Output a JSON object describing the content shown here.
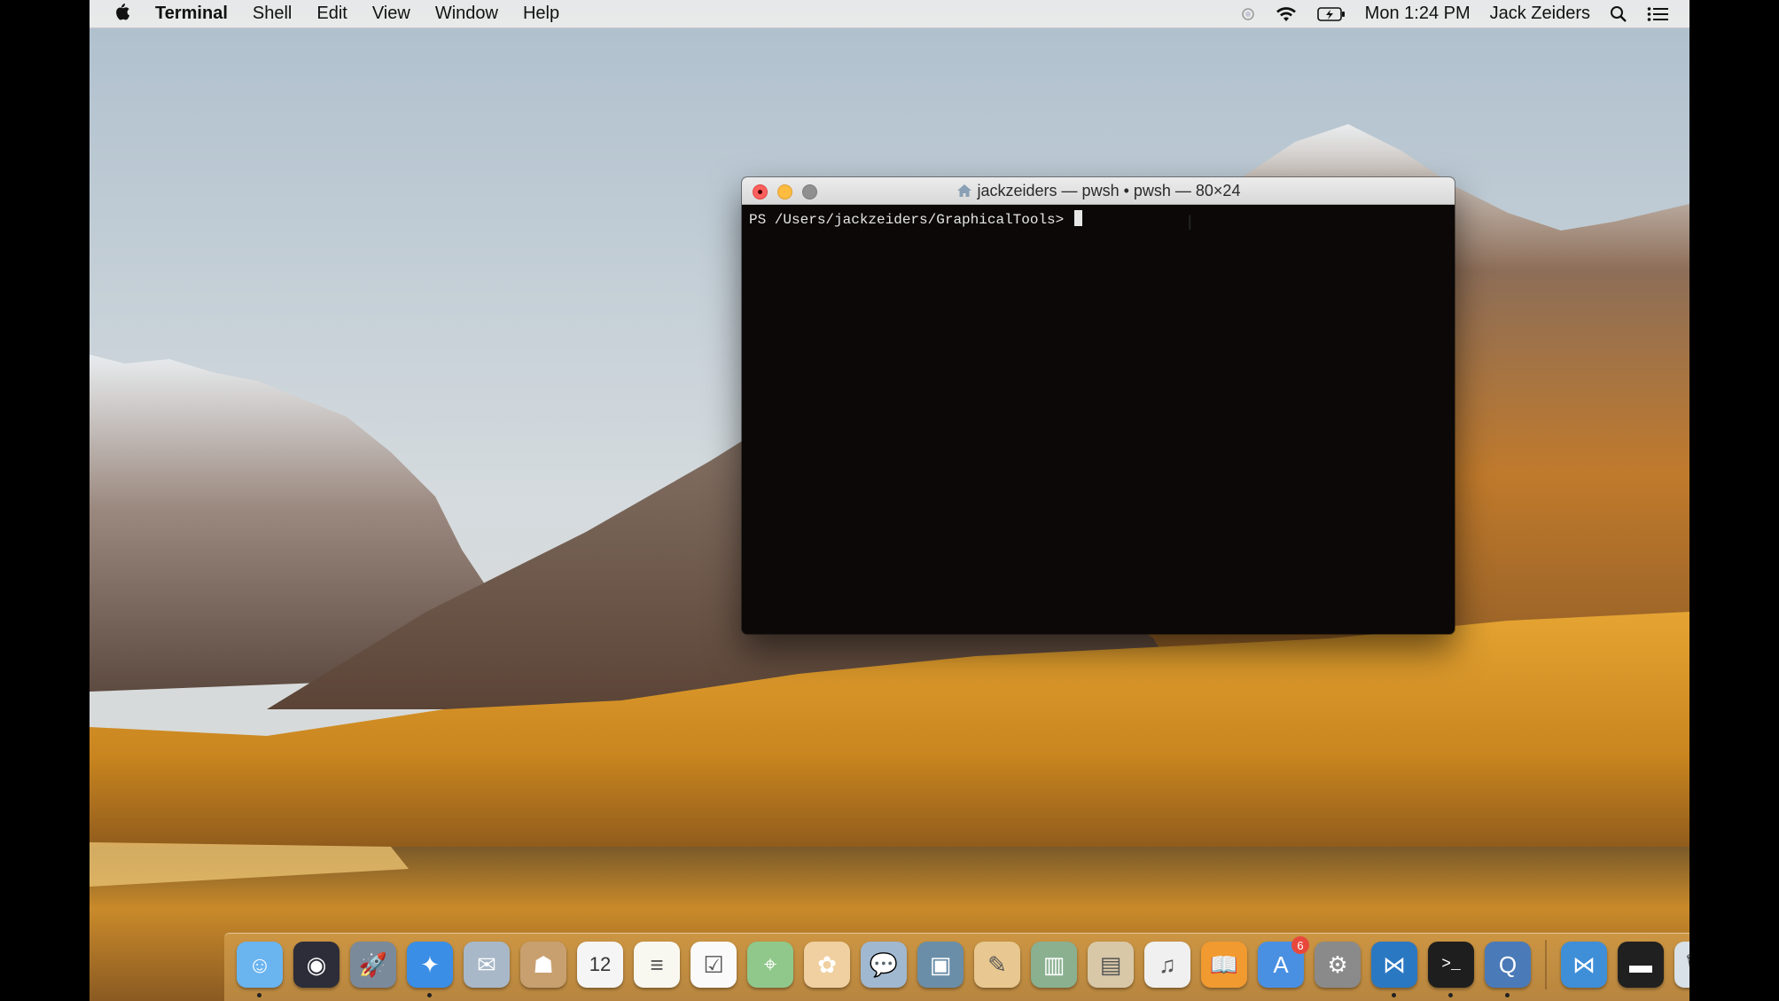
{
  "menubar": {
    "apple_icon": "apple-logo",
    "app_name": "Terminal",
    "menus": [
      "Shell",
      "Edit",
      "View",
      "Window",
      "Help"
    ],
    "clock": "Mon 1:24 PM",
    "user": "Jack Zeiders",
    "status_icons": [
      "siri-dot-icon",
      "wifi-icon",
      "battery-charging-icon",
      "spotlight-search-icon",
      "notification-center-icon"
    ]
  },
  "terminal": {
    "title": "jackzeiders — pwsh • pwsh — 80×24",
    "prompt": "PS /Users/jackzeiders/GraphicalTools> "
  },
  "dock": {
    "apps": [
      {
        "name": "Finder",
        "icon": "finder-icon",
        "color": "#6ab4f0",
        "running": true
      },
      {
        "name": "Siri",
        "icon": "siri-icon",
        "color": "#2d2d3a",
        "running": false
      },
      {
        "name": "Launchpad",
        "icon": "launchpad-icon",
        "color": "#7b8a9a",
        "running": false
      },
      {
        "name": "Safari",
        "icon": "safari-icon",
        "color": "#3a8ee6",
        "running": true
      },
      {
        "name": "Mail",
        "icon": "mail-icon",
        "color": "#a8b8c8",
        "running": false
      },
      {
        "name": "Contacts",
        "icon": "contacts-icon",
        "color": "#c8a070",
        "running": false
      },
      {
        "name": "Calendar",
        "icon": "calendar-icon",
        "color": "#f5f5f5",
        "text": "12",
        "running": false
      },
      {
        "name": "Notes",
        "icon": "notes-icon",
        "color": "#f8f8f0",
        "running": false
      },
      {
        "name": "Reminders",
        "icon": "reminders-icon",
        "color": "#fafafa",
        "running": false
      },
      {
        "name": "Maps",
        "icon": "maps-icon",
        "color": "#8fc88a",
        "running": false
      },
      {
        "name": "Photos",
        "icon": "photos-icon",
        "color": "#f0d0a0",
        "running": false
      },
      {
        "name": "Messages",
        "icon": "messages-icon",
        "color": "#a0b8d0",
        "running": false
      },
      {
        "name": "FaceTime",
        "icon": "facetime-icon",
        "color": "#6a8ea8",
        "running": false
      },
      {
        "name": "Pages",
        "icon": "pages-icon",
        "color": "#e8c890",
        "running": false
      },
      {
        "name": "Numbers",
        "icon": "numbers-icon",
        "color": "#8ab090",
        "running": false
      },
      {
        "name": "Keynote",
        "icon": "keynote-icon",
        "color": "#d8c8a8",
        "running": false
      },
      {
        "name": "iTunes",
        "icon": "itunes-icon",
        "color": "#f0f0f0",
        "running": false
      },
      {
        "name": "iBooks",
        "icon": "ibooks-icon",
        "color": "#f09a30",
        "running": false
      },
      {
        "name": "App Store",
        "icon": "app-store-icon",
        "color": "#4a90e2",
        "badge": "6",
        "running": false
      },
      {
        "name": "System Preferences",
        "icon": "system-preferences-icon",
        "color": "#8a8a8a",
        "running": false
      },
      {
        "name": "Visual Studio Code",
        "icon": "vscode-icon",
        "color": "#2b78c2",
        "running": true
      },
      {
        "name": "Terminal",
        "icon": "terminal-icon",
        "color": "#1e1e1e",
        "running": true
      },
      {
        "name": "QuickTime Player",
        "icon": "quicktime-icon",
        "color": "#4a7ab8",
        "running": true
      }
    ],
    "extras": [
      {
        "name": "Visual Studio Code Insiders",
        "icon": "vscode-insiders-icon",
        "color": "#3f8fd8"
      },
      {
        "name": "Minimized Window",
        "icon": "minimized-window-icon",
        "color": "#202020"
      },
      {
        "name": "Trash",
        "icon": "trash-icon",
        "color": "#d8e0e8"
      }
    ]
  }
}
